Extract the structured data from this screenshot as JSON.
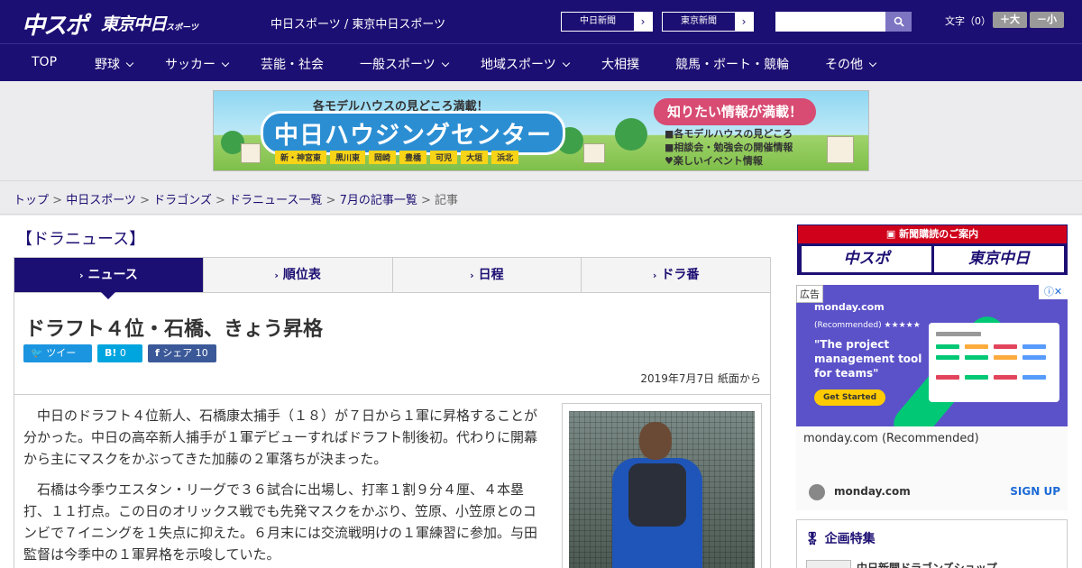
{
  "header": {
    "logo_chuspo": "中スポ",
    "logo_tokyo": "東京中日",
    "logo_tokyo_small": "スポーツ",
    "site_title": "中日スポーツ / 東京中日スポーツ",
    "ext_links": [
      "中日新聞",
      "東京新聞"
    ],
    "search_placeholder": "",
    "fontsize_label": "文字（0）",
    "fontsize_larger": "＋大",
    "fontsize_smaller": "－小"
  },
  "nav": {
    "items": [
      {
        "label": "TOP",
        "dropdown": false
      },
      {
        "label": "野球",
        "dropdown": true
      },
      {
        "label": "サッカー",
        "dropdown": true
      },
      {
        "label": "芸能・社会",
        "dropdown": false
      },
      {
        "label": "一般スポーツ",
        "dropdown": true
      },
      {
        "label": "地域スポーツ",
        "dropdown": true
      },
      {
        "label": "大相撲",
        "dropdown": false
      },
      {
        "label": "競馬・ボート・競輪",
        "dropdown": false
      },
      {
        "label": "その他",
        "dropdown": true
      }
    ]
  },
  "banner": {
    "top_text": "各モデルハウスの見どころ満載！",
    "title": "中日ハウジングセンター",
    "cities": [
      "新・神宮東",
      "黒川東",
      "岡崎",
      "豊橋",
      "可児",
      "大垣",
      "浜北"
    ],
    "right_badge": "知りたい情報が満載！",
    "right_list": [
      "各モデルハウスの見どころ",
      "相談会・勉強会の開催情報",
      "楽しいイベント情報"
    ]
  },
  "breadcrumb": {
    "links": [
      "トップ",
      "中日スポーツ",
      "ドラゴンズ",
      "ドラニュース一覧",
      "7月の記事一覧"
    ],
    "current": "記事",
    "separator": " > "
  },
  "section": {
    "title": "【ドラニュース】",
    "tabs": [
      "ニュース",
      "順位表",
      "日程",
      "ドラ番"
    ],
    "active_tab": 0
  },
  "article": {
    "headline": "ドラフト４位・石橋、きょう昇格",
    "share": {
      "tweet_label": "ツイート",
      "hatena_label": "B!",
      "hatena_count": "0",
      "facebook_label": "シェア",
      "facebook_count": "10"
    },
    "dateline": "2019年7月7日 紙面から",
    "paragraphs": [
      "中日のドラフト４位新人、石橋康太捕手（１８）が７日から１軍に昇格することが分かった。中日の高卒新人捕手が１軍デビューすればドラフト制後初。代わりに開幕から主にマスクをかぶってきた加藤の２軍落ちが決まった。",
      "石橋は今季ウエスタン・リーグで３６試合に出場し、打率１割９分４厘、４本塁打、１１打点。この日のオリックス戦でも先発マスクをかぶり、笠原、小笠原とのコンビで７イニングを１失点に抑えた。６月末には交流戦明けの１軍練習に参加。与田監督は今季中の１軍昇格を示唆していた。"
    ]
  },
  "sidebar": {
    "subscribe_label": "新聞購読のご案内",
    "subscribe_logos": [
      "中スポ",
      "東京中日"
    ],
    "ad": {
      "label": "広告",
      "brand": "monday.com",
      "recommended": "(Recommended) ★★★★★",
      "headline": "\"The project management tool for teams\"",
      "cta": "Get Started",
      "name": "monday.com (Recommended)",
      "domain": "monday.com",
      "signup": "SIGN UP"
    },
    "feature": {
      "title": "企画特集",
      "item": "中日新聞ドラゴンズショップ"
    }
  },
  "colors": {
    "brand": "#1c0f73",
    "accent_red": "#d0021b",
    "twitter": "#1b95e0",
    "hatena": "#00a4de",
    "facebook": "#3b5998"
  }
}
